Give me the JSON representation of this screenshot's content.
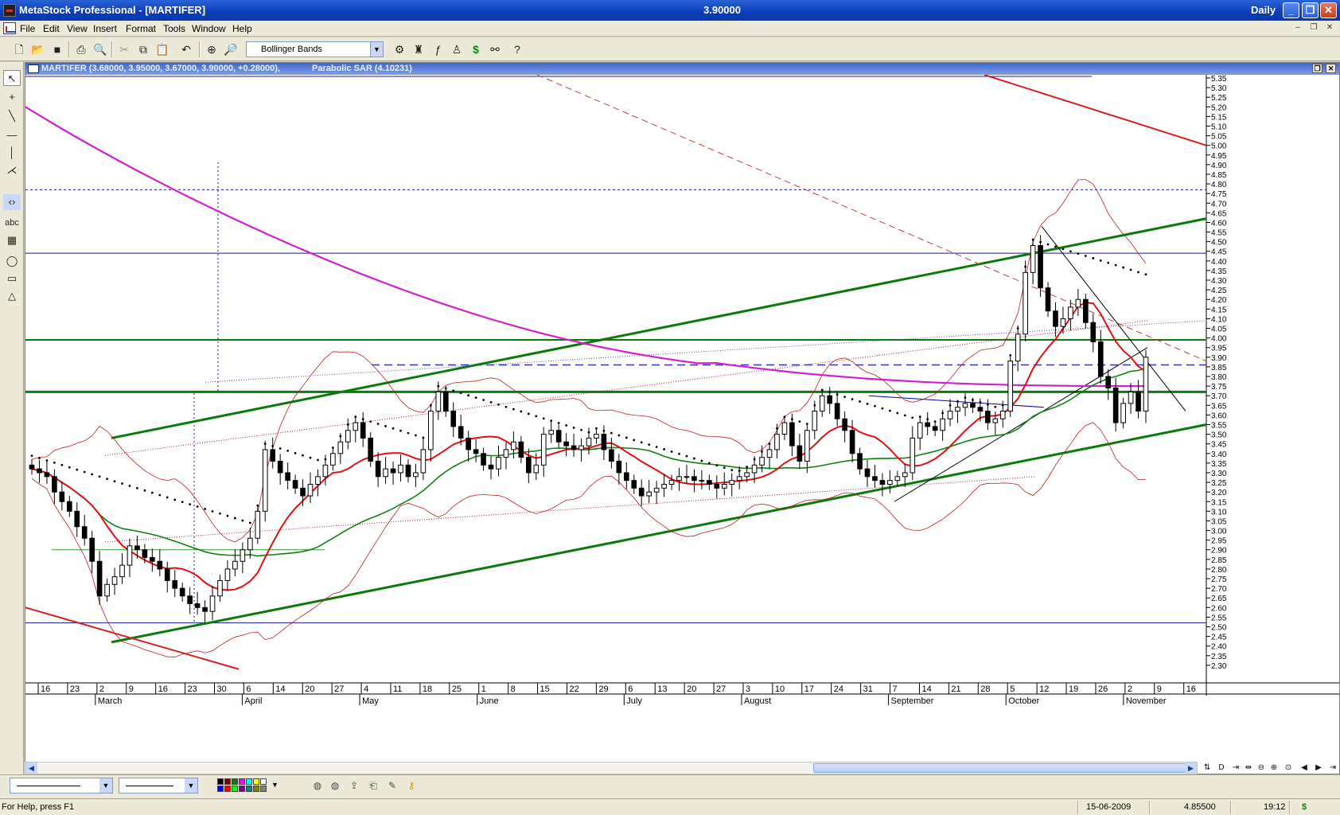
{
  "titlebar": {
    "title": "MetaStock Professional - [MARTIFER]",
    "last_price": "3.90000",
    "period": "Daily",
    "minimize": "_",
    "restore": "❐",
    "close": "✕"
  },
  "menu": {
    "items": [
      "File",
      "Edit",
      "View",
      "Insert",
      "Format",
      "Tools",
      "Window",
      "Help"
    ]
  },
  "toolbar": {
    "indicator_select": "Bollinger Bands"
  },
  "chart_header": {
    "symbol_info": "MARTIFER (3.68000, 3.95000, 3.67000, 3.90000, +0.28000),",
    "indicator_info": "Parabolic SAR (4.10231)"
  },
  "chart_data": {
    "type": "candlestick",
    "symbol": "MARTIFER",
    "ylim": [
      2.25,
      5.35
    ],
    "y_tick_step": 0.05,
    "ohlc_last": {
      "open": 3.68,
      "high": 3.95,
      "low": 3.67,
      "close": 3.9,
      "change": 0.28
    },
    "parabolic_sar": 4.10231,
    "x_day_ticks": [
      "16",
      "23",
      "2",
      "9",
      "16",
      "23",
      "30",
      "6",
      "14",
      "20",
      "27",
      "4",
      "11",
      "18",
      "25",
      "1",
      "8",
      "15",
      "22",
      "29",
      "6",
      "13",
      "20",
      "27",
      "3",
      "10",
      "17",
      "24",
      "31",
      "7",
      "14",
      "21",
      "28",
      "5",
      "12",
      "19",
      "26",
      "2",
      "9",
      "16"
    ],
    "x_month_labels": [
      "March",
      "April",
      "May",
      "June",
      "July",
      "August",
      "September",
      "October",
      "November"
    ],
    "horizontal_levels": [
      4.77,
      4.44,
      3.99,
      3.86,
      3.72,
      2.52
    ],
    "close_series": [
      3.32,
      3.3,
      3.28,
      3.2,
      3.15,
      3.1,
      3.02,
      2.96,
      2.84,
      2.66,
      2.72,
      2.76,
      2.82,
      2.92,
      2.9,
      2.86,
      2.84,
      2.8,
      2.74,
      2.7,
      2.66,
      2.62,
      2.6,
      2.58,
      2.66,
      2.74,
      2.8,
      2.84,
      2.9,
      2.96,
      3.1,
      3.42,
      3.36,
      3.3,
      3.26,
      3.22,
      3.18,
      3.24,
      3.28,
      3.34,
      3.4,
      3.46,
      3.52,
      3.56,
      3.48,
      3.36,
      3.28,
      3.32,
      3.3,
      3.34,
      3.28,
      3.3,
      3.42,
      3.62,
      3.72,
      3.62,
      3.54,
      3.48,
      3.42,
      3.4,
      3.34,
      3.32,
      3.38,
      3.42,
      3.46,
      3.38,
      3.3,
      3.34,
      3.5,
      3.52,
      3.46,
      3.44,
      3.42,
      3.44,
      3.48,
      3.5,
      3.42,
      3.36,
      3.3,
      3.26,
      3.22,
      3.18,
      3.2,
      3.22,
      3.24,
      3.26,
      3.28,
      3.28,
      3.26,
      3.26,
      3.24,
      3.22,
      3.24,
      3.26,
      3.28,
      3.3,
      3.34,
      3.38,
      3.42,
      3.5,
      3.56,
      3.44,
      3.36,
      3.52,
      3.62,
      3.7,
      3.66,
      3.58,
      3.52,
      3.4,
      3.32,
      3.28,
      3.26,
      3.24,
      3.26,
      3.28,
      3.3,
      3.48,
      3.56,
      3.54,
      3.52,
      3.58,
      3.62,
      3.64,
      3.66,
      3.64,
      3.62,
      3.56,
      3.58,
      3.62,
      3.88,
      4.02,
      4.34,
      4.48,
      4.26,
      4.14,
      4.06,
      4.1,
      4.16,
      4.2,
      4.08,
      3.98,
      3.8,
      3.74,
      3.56,
      3.66,
      3.72,
      3.62,
      3.9
    ],
    "ma_red_period": 10,
    "ma_green_period": 30,
    "ma_magenta_period": 200
  },
  "statusbar": {
    "help": "For Help, press F1",
    "date": "15-06-2009",
    "value": "4.85500",
    "time": "19:12",
    "dollar": "$"
  }
}
